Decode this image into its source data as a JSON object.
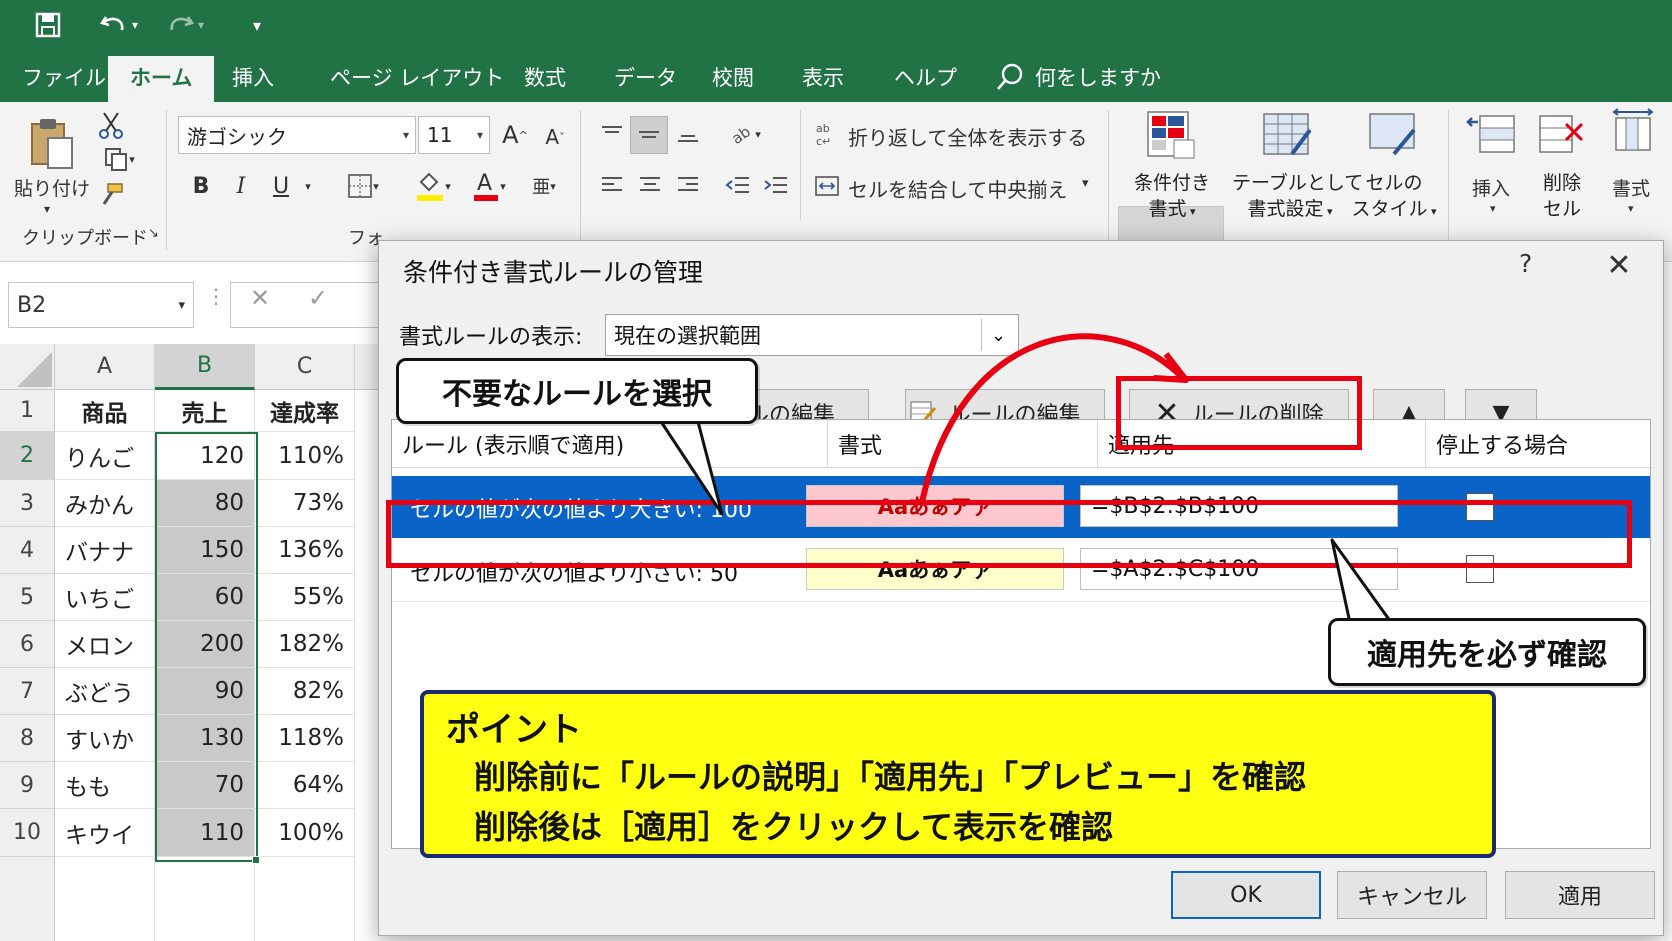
{
  "colors": {
    "excel_green": "#217346",
    "selection_blue": "#0a64c8",
    "annotation_red": "#e60012",
    "point_yellow": "#ffff11"
  },
  "qat": {
    "save_icon": "save-icon",
    "undo_icon": "undo-icon",
    "redo_icon": "redo-icon",
    "customize_icon": "customize-qat-icon"
  },
  "tabs": {
    "file": "ファイル",
    "home": "ホーム",
    "insert": "挿入",
    "page_layout": "ページ レイアウト",
    "formulas": "数式",
    "data": "データ",
    "review": "校閲",
    "view": "表示",
    "help": "ヘルプ",
    "tell_me": "何をしますか"
  },
  "ribbon": {
    "paste": "貼り付け",
    "clipboard_group": "クリップボード",
    "font_group": "フォ",
    "font_name": "游ゴシック",
    "font_size": "11",
    "bold": "B",
    "italic": "I",
    "underline": "U",
    "wrap_text": "折り返して全体を表示する",
    "merge_center": "セルを結合して中央揃え",
    "cond_format": [
      "条件付き",
      "書式"
    ],
    "format_table": [
      "テーブルとして",
      "書式設定"
    ],
    "cell_styles": [
      "セルの",
      "スタイル"
    ],
    "insert": "挿入",
    "delete": [
      "削除",
      "セル"
    ],
    "format": "書式"
  },
  "formula_bar": {
    "name_box": "B2"
  },
  "sheet": {
    "columns": [
      "A",
      "B",
      "C"
    ],
    "rows": [
      "1",
      "2",
      "3",
      "4",
      "5",
      "6",
      "7",
      "8",
      "9",
      "10"
    ],
    "header": [
      "商品",
      "売上",
      "達成率"
    ],
    "data": [
      [
        "りんご",
        "120",
        "110%"
      ],
      [
        "みかん",
        "80",
        "73%"
      ],
      [
        "バナナ",
        "150",
        "136%"
      ],
      [
        "いちご",
        "60",
        "55%"
      ],
      [
        "メロン",
        "200",
        "182%"
      ],
      [
        "ぶどう",
        "90",
        "82%"
      ],
      [
        "すいか",
        "130",
        "118%"
      ],
      [
        "もも",
        "70",
        "64%"
      ],
      [
        "キウイ",
        "110",
        "100%"
      ]
    ]
  },
  "dialog": {
    "title": "条件付き書式ルールの管理",
    "help": "?",
    "show_rules_label": "書式ルールの表示:",
    "show_rules_value": "現在の選択範囲",
    "new_rule_partial": "ルールの編集...",
    "edit_rule_partial": "ルールの編集...",
    "delete_rule": "ルールの削除",
    "move_up": "▲",
    "move_down": "▼",
    "columns": {
      "rule": "ルール (表示順で適用)",
      "format": "書式",
      "applies_to": "適用先",
      "stop_if_true": "停止する場合"
    },
    "rules": [
      {
        "text": "セルの値が次の値より大きい:  100",
        "preview": "Aaあぁアァ",
        "applies_to": "=$B$2:$B$100",
        "preview_bg": "#ffc7ce",
        "preview_fg": "#c00000"
      },
      {
        "text": "セルの値が次の値より小さい: 50",
        "preview": "Aaあぁアァ",
        "applies_to": "=$A$2:$C$100",
        "preview_bg": "#ffffcc",
        "preview_fg": "#111111"
      }
    ],
    "ok": "OK",
    "cancel": "キャンセル",
    "apply": "適用"
  },
  "annotations": {
    "select_rule": "不要なルールを選択",
    "check_applies_to": "適用先を必ず確認",
    "point_title": "ポイント",
    "point_line1": "削除前に「ルールの説明」「適用先」「プレビュー」を確認",
    "point_line2": "削除後は［適用］をクリックして表示を確認"
  }
}
